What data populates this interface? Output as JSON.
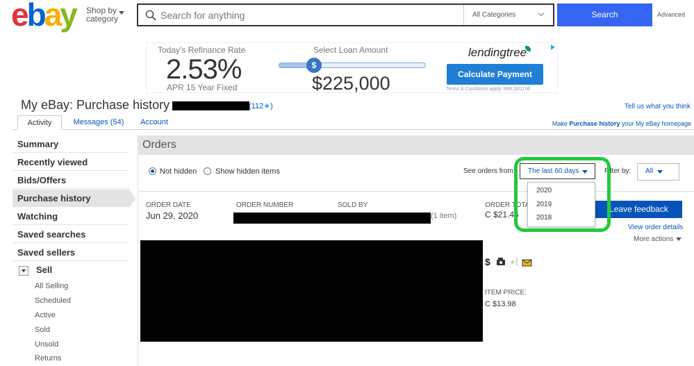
{
  "header": {
    "logo": {
      "e": "e",
      "b": "b",
      "a": "a",
      "y": "y"
    },
    "shop_by_line1": "Shop by",
    "shop_by_line2": "category",
    "search_placeholder": "Search for anything",
    "category_select": "All Categories",
    "search_button": "Search",
    "advanced": "Advanced"
  },
  "ad": {
    "rate_label": "Today's Refinance Rate",
    "rate": "2.53%",
    "apr": "APR 15 Year Fixed",
    "loan_label": "Select Loan Amount",
    "slider_thumb": "$",
    "slider_level": 0.2,
    "amount": "$225,000",
    "brand": "lendingtree",
    "cta": "Calculate Payment",
    "terms": "Terms & Conditions apply. NMLS#1136"
  },
  "page": {
    "title": "My eBay: Purchase history",
    "feedback_count": "(112",
    "feedback_star": "★",
    "feedback_close": ")",
    "tell_us": "Tell us what you think"
  },
  "tabs": [
    {
      "label": "Activity"
    },
    {
      "label": "Messages (54)"
    },
    {
      "label": "Account"
    }
  ],
  "make_home": {
    "prefix": "Make ",
    "bold": "Purchase history",
    "suffix": " your My eBay homepage"
  },
  "sidebar": {
    "items": [
      {
        "label": "Summary"
      },
      {
        "label": "Recently viewed"
      },
      {
        "label": "Bids/Offers"
      },
      {
        "label": "Purchase history"
      },
      {
        "label": "Watching"
      },
      {
        "label": "Saved searches"
      },
      {
        "label": "Saved sellers"
      }
    ],
    "sell_label": "Sell",
    "sell_items": [
      {
        "label": "All Selling"
      },
      {
        "label": "Scheduled"
      },
      {
        "label": "Active"
      },
      {
        "label": "Sold"
      },
      {
        "label": "Unsold"
      },
      {
        "label": "Returns"
      }
    ]
  },
  "orders": {
    "heading": "Orders",
    "not_hidden": "Not hidden",
    "show_hidden": "Show hidden items",
    "see_orders_from": "See orders from:",
    "period_selected": "The last 60 days",
    "filter_by": "Filter by:",
    "filter_selected": "All",
    "period_options": [
      "2020",
      "2019",
      "2018"
    ],
    "columns": {
      "order_date": "ORDER DATE",
      "order_number": "ORDER NUMBER",
      "sold_by": "SOLD BY",
      "order_total": "ORDER TOTAL"
    },
    "order": {
      "date": "Jun 29, 2020",
      "item_count": "(1 item)",
      "total": "C $21.45",
      "leave_feedback": "Leave feedback",
      "view_details": "View order details",
      "more_actions": "More actions",
      "item_price_label": "ITEM PRICE:",
      "item_price": "C $13.98"
    }
  },
  "colors": {
    "accent": "#3665f3",
    "link": "#0654ba",
    "highlight": "#23c93d"
  }
}
